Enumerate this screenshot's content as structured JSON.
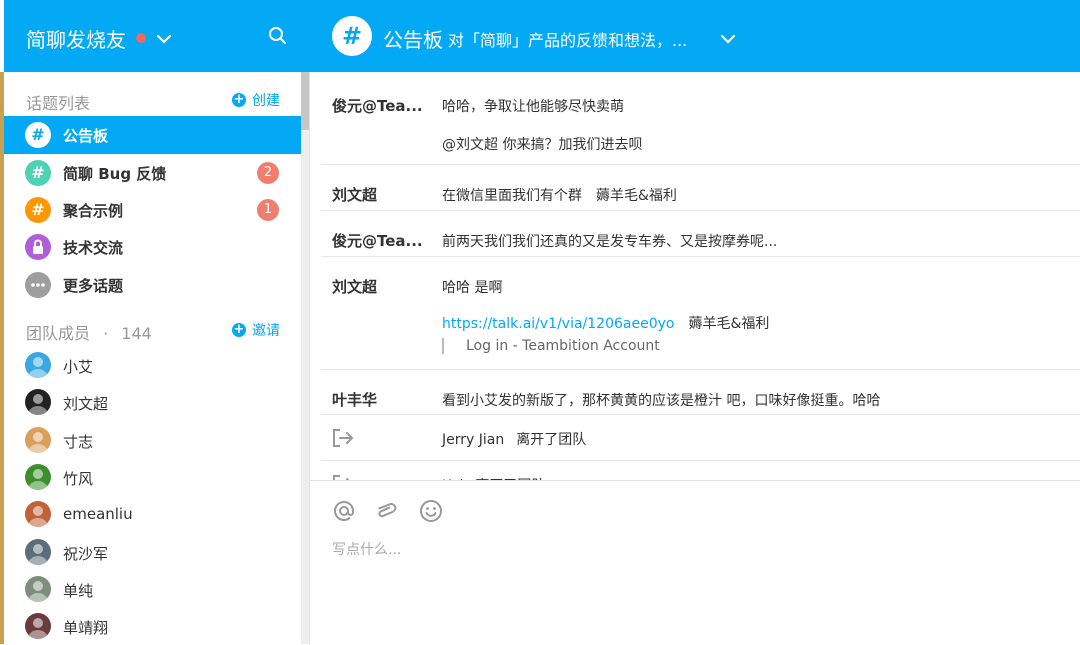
{
  "team": {
    "name": "简聊发烧友"
  },
  "sidebar": {
    "topics_header": "话题列表",
    "create_label": "创建",
    "topics": [
      {
        "label": "公告板",
        "icon": "hash-icon",
        "color": "#03a9f4",
        "active": true,
        "badge": ""
      },
      {
        "label": "简聊 Bug 反馈",
        "icon": "hash-icon",
        "color": "#4fd1b5",
        "badge": "2"
      },
      {
        "label": "聚合示例",
        "icon": "hash-icon",
        "color": "#ff9800",
        "badge": "1"
      },
      {
        "label": "技术交流",
        "icon": "lock-icon",
        "color": "#b05fd8",
        "badge": ""
      },
      {
        "label": "更多话题",
        "icon": "more-icon",
        "color": "#9e9e9e",
        "badge": ""
      }
    ],
    "members_header": "团队成员",
    "members_sep": "·",
    "members_count": "144",
    "invite_label": "邀请",
    "members": [
      {
        "name": "小艾",
        "avatar_color": "#3aa8e0"
      },
      {
        "name": "刘文超",
        "avatar_color": "#222222"
      },
      {
        "name": "寸志",
        "avatar_color": "#d9a05b"
      },
      {
        "name": "竹风",
        "avatar_color": "#3f8f2f"
      },
      {
        "name": "emeanliu",
        "avatar_color": "#c0623a"
      },
      {
        "name": "祝沙军",
        "avatar_color": "#5a6e7a"
      },
      {
        "name": "单纯",
        "avatar_color": "#7d8f7a"
      },
      {
        "name": "单靖翔",
        "avatar_color": "#6b3a3a"
      }
    ]
  },
  "channel": {
    "title": "公告板",
    "description": "对「简聊」产品的反馈和想法，..."
  },
  "messages": [
    {
      "sender": "俊元@Tea...",
      "lines": [
        "哈哈，争取让他能够尽快卖萌",
        "@刘文超 你来搞？加我们进去呗"
      ]
    },
    {
      "sender": "刘文超",
      "lines": [
        "在微信里面我们有个群　薅羊毛&福利"
      ]
    },
    {
      "sender": "俊元@Tea...",
      "lines": [
        "前两天我们我们还真的又是发专车券、又是按摩券呢..."
      ]
    },
    {
      "sender": "刘文超",
      "lines": [
        "哈哈 是啊"
      ],
      "link": "https://talk.ai/v1/via/1206aee0yo",
      "link_suffix": "　薅羊毛&福利",
      "preview": "Log in - Teambition Account"
    },
    {
      "sender": "叶丰华",
      "lines": [
        "看到小艾发的新版了，那杯黄黄的应该是橙汁 吧，口味好像挺重。哈哈"
      ]
    },
    {
      "system": true,
      "user": "Jerry Jian",
      "action": "离开了团队"
    },
    {
      "system": true,
      "user": "Kai",
      "action": "离开了团队"
    }
  ],
  "composer": {
    "placeholder": "写点什么..."
  }
}
